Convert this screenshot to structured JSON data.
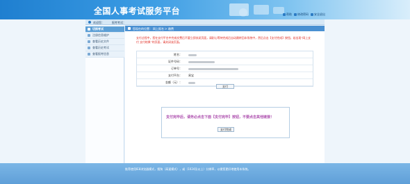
{
  "header": {
    "title": "全国人事考试服务平台",
    "links": [
      {
        "label": "帮助",
        "icon": "help-icon"
      },
      {
        "label": "修改密码",
        "icon": "key-icon"
      },
      {
        "label": "安全退出",
        "icon": "exit-icon"
      }
    ]
  },
  "welcome": {
    "prefix": "欢迎您：",
    "suffix": "报考考试："
  },
  "sidebar": {
    "items": [
      {
        "label": "切换考试",
        "active": true
      },
      {
        "label": "注册信息维护",
        "active": false
      },
      {
        "label": "查看历史文件",
        "active": false
      },
      {
        "label": "查看历史考试",
        "active": false
      },
      {
        "label": "查看报考信息",
        "active": false
      }
    ]
  },
  "breadcrumb": {
    "prefix": "您现在的位置：",
    "step1": "网上报名",
    "step2": "缴费"
  },
  "notice": "支付过程中，您在支付平台中完成交费后不要立即关闭页面，请耐心等待完成后自动跳转回本系统中，然后点击【支付完成】按钮，若出现“网上支付 支付结果”的页面，请关闭该页面。",
  "form": {
    "rows": [
      {
        "label": "姓名："
      },
      {
        "label": "证件号码："
      },
      {
        "label": "订单号："
      },
      {
        "label": "支付平台：",
        "value": "易宝"
      },
      {
        "label": "金额（元）："
      }
    ],
    "pay_button": "支付"
  },
  "success": {
    "message": "支付完毕后，请务必点击下面【支付完毕】按钮，不要点击其他链接！",
    "button": "支付完成"
  },
  "footer": {
    "text": "推荐使用IE8浏览器模式，搜狗（高速模式），或（1024及以上）分辨率，以便您更好地使用本系统。"
  },
  "colors": {
    "header": "#1f7fd0",
    "accent": "#4a90d2",
    "notice": "#e0281f",
    "success": "#ad4fae"
  }
}
